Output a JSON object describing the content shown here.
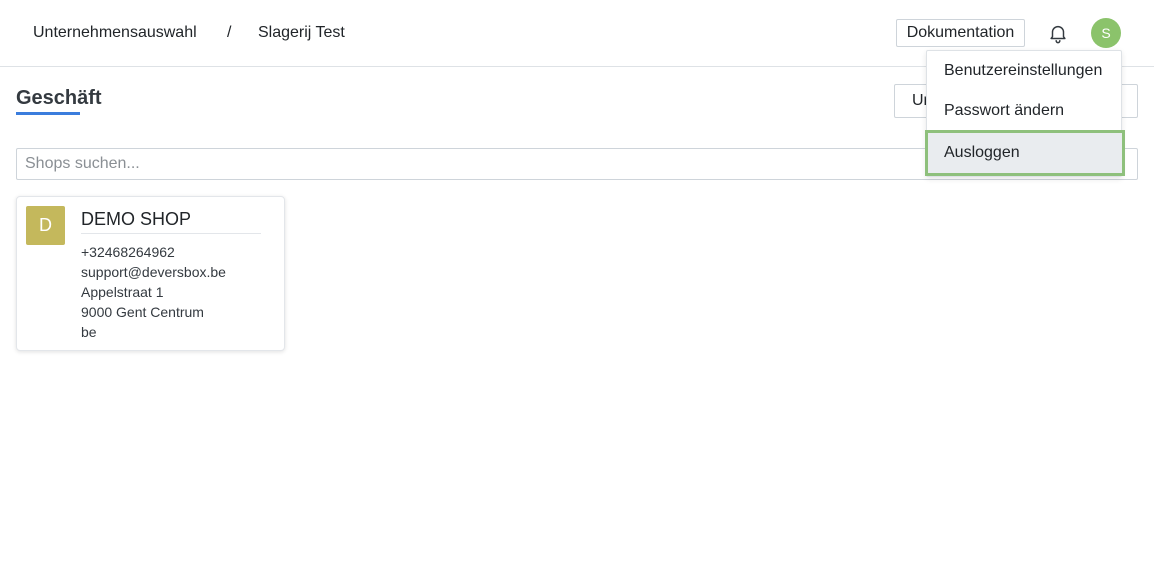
{
  "header": {
    "breadcrumb": [
      "Unternehmensauswahl",
      "/",
      "Slagerij Test"
    ],
    "documentation_label": "Dokumentation",
    "notification_icon": "bell-icon",
    "avatar_initial": "S",
    "avatar_color": "#8bc36b"
  },
  "page": {
    "title": "Geschäft",
    "title_accent": "#3b7ddd",
    "right_button_visible_text": "Ur"
  },
  "search": {
    "placeholder": "Shops suchen...",
    "value": ""
  },
  "shops": [
    {
      "initial": "D",
      "initial_color": "#c4b85c",
      "name": "DEMO SHOP",
      "phone": "+32468264962",
      "email": "support@deversbox.be",
      "street": "Appelstraat 1",
      "city": "9000 Gent Centrum",
      "country": "be"
    }
  ],
  "user_menu": {
    "items": [
      "Benutzereinstellungen",
      "Passwort ändern",
      "Ausloggen"
    ],
    "highlighted": "Ausloggen",
    "highlight_color": "#8ec07c"
  }
}
